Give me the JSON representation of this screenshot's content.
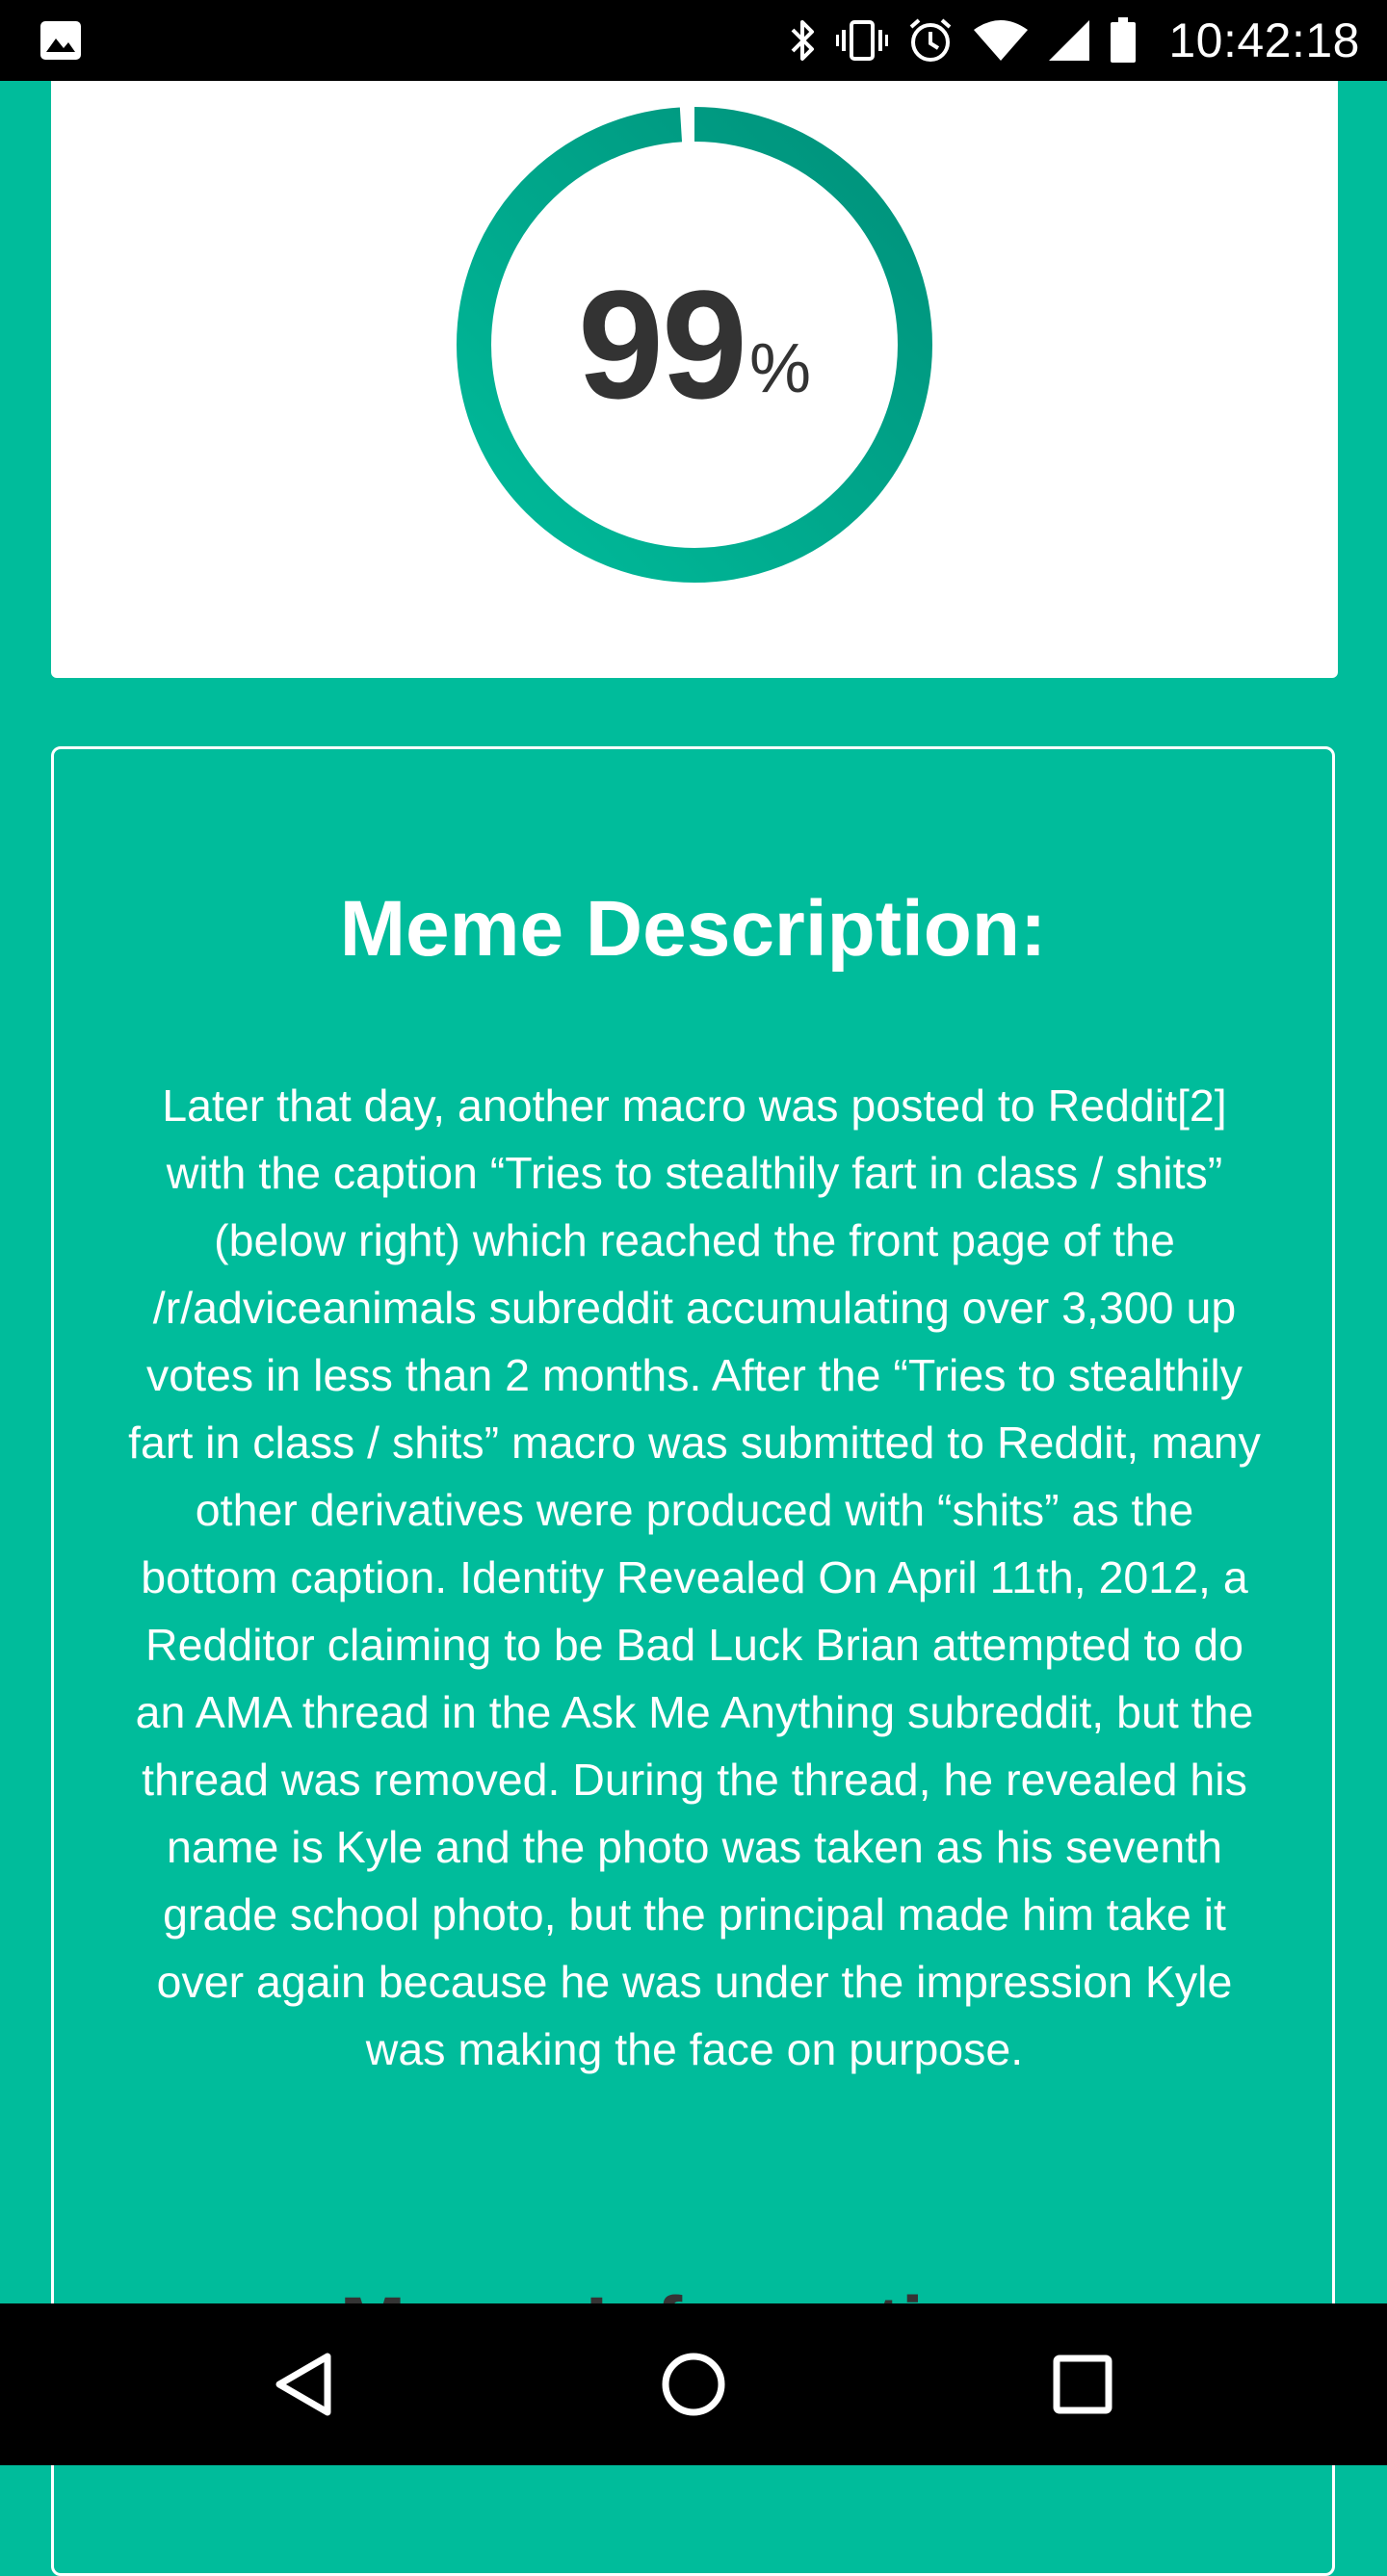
{
  "status_bar": {
    "time": "10:42:18",
    "icons": [
      "image-icon",
      "bluetooth-icon",
      "vibrate-icon",
      "alarm-icon",
      "wifi-icon",
      "signal-icon",
      "battery-icon"
    ]
  },
  "score": {
    "value": "99",
    "unit": "%",
    "progress": 0.99,
    "colors": {
      "ring_start": "#00bc9b",
      "ring_end": "#00907a"
    }
  },
  "description": {
    "title": "Meme Description:",
    "body": "Later that day, another macro was posted to Reddit[2] with the caption “Tries to stealthily fart in class / shits” (below right) which reached the front page of the /r/adviceanimals subreddit accumulating over 3,300 up votes in less than 2 months. After the “Tries to stealthily fart in class / shits” macro was submitted to Reddit, many other derivatives were produced with “shits” as the bottom caption. Identity Revealed On April 11th, 2012, a Redditor claiming to be Bad Luck Brian attempted to do an AMA thread in the Ask Me Anything subreddit, but the thread was removed. During the thread, he revealed his name is Kyle and the photo was taken as his seventh grade school photo, but the principal made him take it over again because he was under the impression Kyle was making the face on purpose.",
    "next_section_title": "Meme Information:"
  },
  "theme": {
    "background": "#00bc9b",
    "text_dark": "#333333"
  },
  "nav_bar": {
    "buttons": [
      "back-icon",
      "home-icon",
      "recents-icon"
    ]
  }
}
